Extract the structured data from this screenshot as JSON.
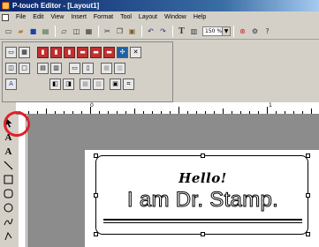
{
  "window": {
    "title": "P-touch Editor - [Layout1]"
  },
  "menu": [
    "File",
    "Edit",
    "View",
    "Insert",
    "Format",
    "Tool",
    "Layout",
    "Window",
    "Help"
  ],
  "toolbar": {
    "zoom_value": "150 %",
    "text_tool_glyph": "T"
  },
  "ruler": {
    "numbers": [
      "0",
      "1"
    ]
  },
  "tool_palette": {
    "select_tool": "arrow",
    "text_tool_glyph": "A",
    "vertical_text_glyph": "A"
  },
  "label": {
    "line1": "Hello!",
    "line2": "I am Dr. Stamp."
  },
  "colors": {
    "title_bar": "#0a246a",
    "highlight_circle": "#e0202a",
    "canvas_bg": "#8c8c8c",
    "chrome": "#d4d0c8"
  }
}
